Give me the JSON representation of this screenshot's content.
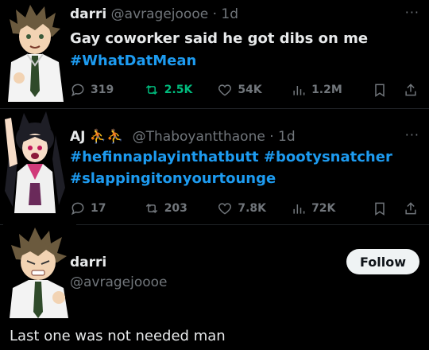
{
  "tweet1": {
    "name": "darri",
    "handle": "@avragejoooe",
    "time": "· 1d",
    "more": "···",
    "line1": "Gay coworker said he got dibs on me",
    "hashtag": "#WhatDatMean",
    "replies": "319",
    "retweets": "2.5K",
    "likes": "54K",
    "views": "1.2M"
  },
  "tweet2": {
    "name": "AJ",
    "emoji": "⛹⛹",
    "handle": "@Thaboyantthaone",
    "time": "· 1d",
    "more": "···",
    "line1": "#hefinnaplayinthatbutt #bootysnatcher",
    "line2": "#slappingitonyourtounge",
    "replies": "17",
    "retweets": "203",
    "likes": "7.8K",
    "views": "72K"
  },
  "reply": {
    "name": "darri",
    "handle": "@avragejoooe",
    "follow_label": "Follow",
    "text": "Last one was not needed man"
  },
  "colors": {
    "background": "#000000",
    "link": "#1d9bf0",
    "retweet_active": "#00ba7c",
    "muted": "#71767b"
  }
}
